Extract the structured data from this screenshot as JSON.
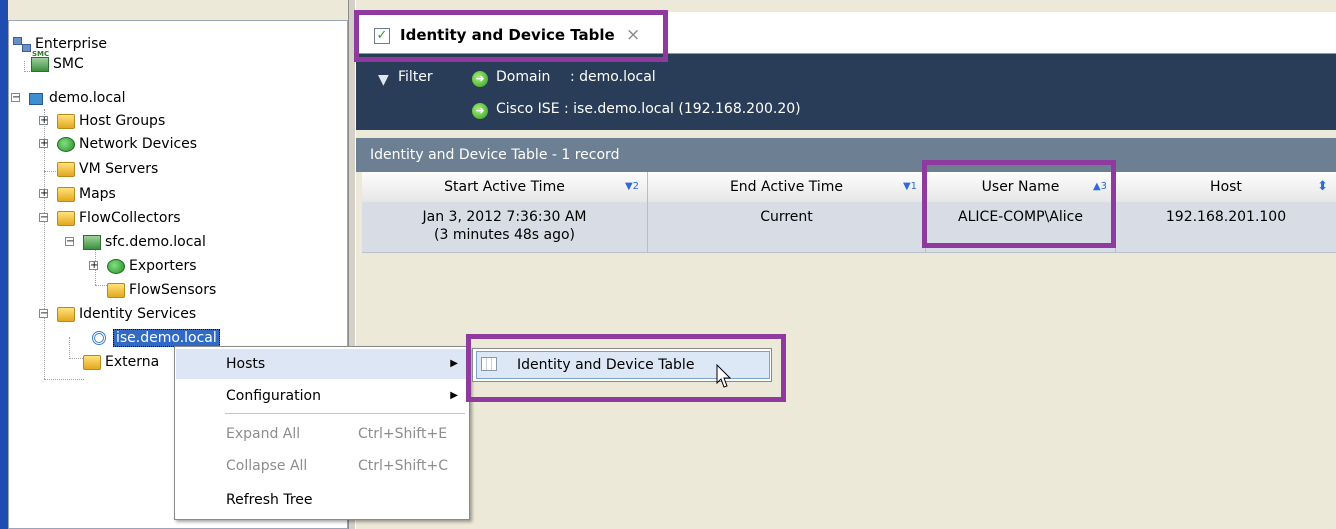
{
  "tree": {
    "items": [
      {
        "label": "Enterprise"
      },
      {
        "label": "SMC",
        "badge": "SMC"
      },
      {
        "label": "demo.local"
      },
      {
        "label": "Host Groups"
      },
      {
        "label": "Network Devices"
      },
      {
        "label": "VM Servers"
      },
      {
        "label": "Maps"
      },
      {
        "label": "FlowCollectors"
      },
      {
        "label": "sfc.demo.local"
      },
      {
        "label": "Exporters"
      },
      {
        "label": "FlowSensors"
      },
      {
        "label": "Identity Services"
      },
      {
        "label": "ise.demo.local"
      },
      {
        "label": "Externa"
      }
    ]
  },
  "tab": {
    "title": "Identity and Device Table",
    "close_glyph": "×"
  },
  "filter": {
    "label": "Filter",
    "domain_key": "Domain",
    "domain_value": ": demo.local",
    "ise_text": "Cisco ISE : ise.demo.local (192.168.200.20)"
  },
  "table": {
    "caption": "Identity and Device Table - 1 record",
    "columns": [
      {
        "label": "Start Active Time",
        "sort": "▼2"
      },
      {
        "label": "End Active Time",
        "sort": "▼1"
      },
      {
        "label": "User Name",
        "sort": "▲3"
      },
      {
        "label": "Host",
        "sort": "⬍"
      }
    ],
    "rows": [
      {
        "start_line1": "Jan 3, 2012 7:36:30 AM",
        "start_line2": "(3 minutes 48s ago)",
        "end": "Current",
        "user": "ALICE-COMP\\Alice",
        "host": "192.168.201.100"
      }
    ]
  },
  "context_menu": {
    "items": [
      {
        "label": "Hosts",
        "arrow": "▶"
      },
      {
        "label": "Configuration",
        "arrow": "▶"
      },
      {
        "label": "Expand All",
        "shortcut": "Ctrl+Shift+E"
      },
      {
        "label": "Collapse All",
        "shortcut": "Ctrl+Shift+C"
      },
      {
        "label": "Refresh Tree"
      }
    ]
  },
  "submenu": {
    "item": "Identity and Device Table"
  },
  "colors": {
    "highlight": "#8e3a9e",
    "filter_bar": "#2a3d58",
    "selection": "#316ac5"
  }
}
